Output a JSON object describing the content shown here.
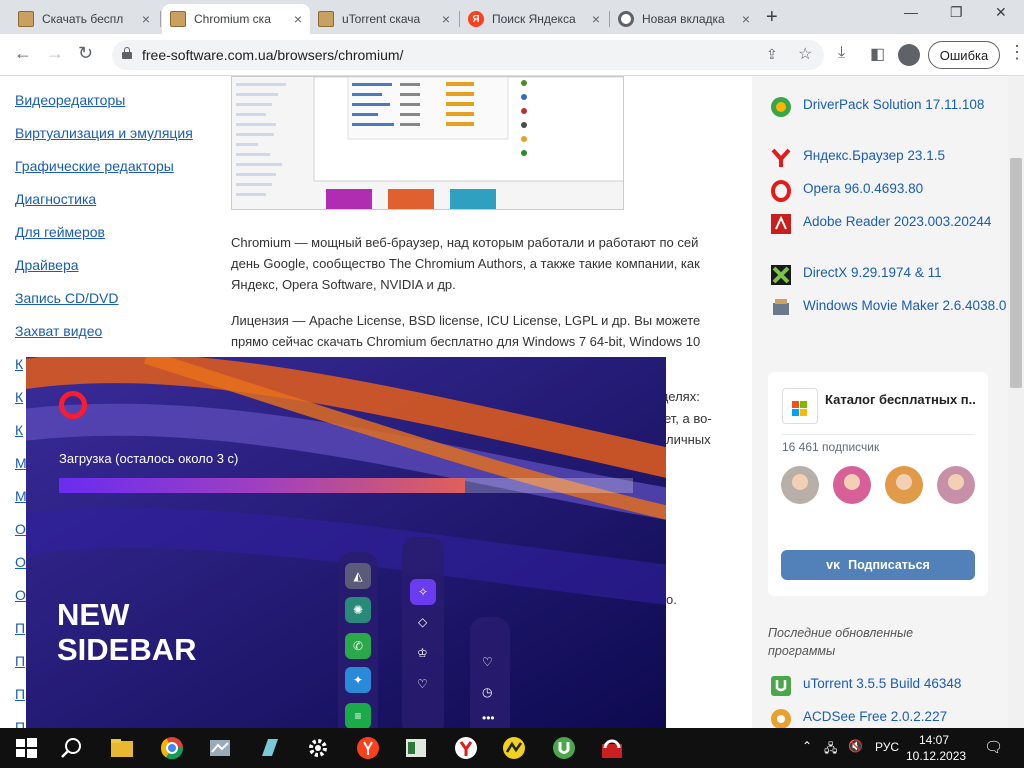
{
  "tabs": [
    {
      "title": "Скачать беспл",
      "favicon": "site-favicon-icon"
    },
    {
      "title": "Chromium ска",
      "favicon": "site-favicon-icon",
      "active": true
    },
    {
      "title": "uTorrent скача",
      "favicon": "site-favicon-icon"
    },
    {
      "title": "Поиск Яндекса",
      "favicon": "yandex-icon"
    },
    {
      "title": "Новая вкладка",
      "favicon": "chrome-icon"
    }
  ],
  "tab_close": "×",
  "toolbar": {
    "url": "free-software.com.ua/browsers/chromium/",
    "error_label": "Ошибка"
  },
  "left_nav": [
    "Видеоредакторы",
    "Виртуализация и эмуляция",
    "Графические редакторы",
    "Диагностика",
    "Для геймеров",
    "Драйвера",
    "Запись CD/DVD",
    "Захват видео"
  ],
  "left_nav_cut": [
    "К",
    "К",
    "К",
    "М",
    "М",
    "О",
    "О",
    "О",
    "П",
    "П",
    "П",
    "П"
  ],
  "article": {
    "p1": "Chromium — мощный веб-браузер, над которым работали и работают по сей день Google, сообщество The Chromium Authors, а также такие компании, как Яндекс, Opera Software, NVIDIA и др.",
    "p2": "Лицензия — Apache License, BSD license, ICU License, LGPL и др. Вы можете прямо сейчас скачать Chromium бесплатно для Windows 7 64-bit, Windows 10",
    "frag1": "целях:",
    "frag2": "ет, а во-",
    "frag3": "личных",
    "frag4": "о."
  },
  "right_software": [
    {
      "name": "DriverPack Solution 17.11.108",
      "icon": "driverpack-icon",
      "color": "#3aa64a"
    },
    {
      "name": "Яндекс.Браузер 23.1.5",
      "icon": "yandex-icon",
      "color": "#e41b1b"
    },
    {
      "name": "Opera 96.0.4693.80",
      "icon": "opera-icon",
      "color": "#e41b1b"
    },
    {
      "name": "Adobe Reader 2023.003.20244",
      "icon": "adobe-reader-icon",
      "color": "#c8201e"
    },
    {
      "name": "DirectX 9.29.1974 & 11",
      "icon": "directx-icon",
      "color": "#4a8a2a"
    },
    {
      "name": "Windows Movie Maker 2.6.4038.0",
      "icon": "movie-maker-icon",
      "color": "#6a7a8a"
    }
  ],
  "vk_widget": {
    "title": "Каталог бесплатных п...",
    "subscribers": "16 461 подписчик",
    "button": "Подписаться"
  },
  "updated": {
    "heading": "Последние обновленные программы",
    "items": [
      {
        "name": "uTorrent 3.5.5 Build 46348",
        "icon": "utorrent-icon",
        "color": "#4aa84a"
      },
      {
        "name": "ACDSee Free 2.0.2.227",
        "icon": "acdsee-icon",
        "color": "#e8a030"
      }
    ]
  },
  "opera_installer": {
    "status": "Загрузка (осталось около 3 с)",
    "progress": 0.707,
    "headline_1": "NEW",
    "headline_2": "SIDEBAR"
  },
  "taskbar": {
    "apps": [
      "file-explorer-icon",
      "chrome-icon",
      "app-icon",
      "app-icon",
      "gear-icon",
      "yandex-icon",
      "app-icon",
      "yandex-browser-icon",
      "app-icon",
      "utorrent-icon",
      "app-icon"
    ],
    "lang": "РУС",
    "time": "14:07",
    "date": "10.12.2023"
  },
  "colors": {
    "link": "#1a5db5",
    "opera_red": "#ff1b2d",
    "vk_blue": "#5181b8"
  }
}
